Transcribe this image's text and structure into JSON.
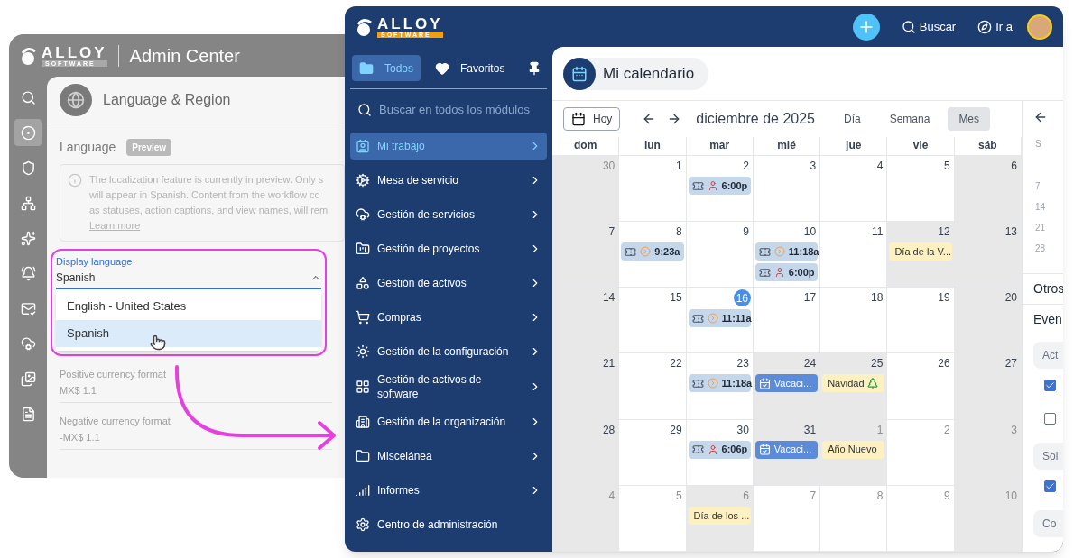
{
  "admin_window": {
    "logo": {
      "name": "ALLOY",
      "sub": "SOFTWARE"
    },
    "title": "Admin Center",
    "rail_items": [
      {
        "selected": false
      },
      {
        "selected": true
      },
      {
        "selected": false
      },
      {
        "selected": false
      },
      {
        "selected": false
      },
      {
        "selected": false
      },
      {
        "selected": false
      },
      {
        "selected": false
      },
      {
        "selected": false
      },
      {
        "selected": false
      }
    ],
    "page_title": "Language & Region",
    "section": "Language",
    "badge": "Preview",
    "info_lines": [
      "The localization feature is currently in preview. Only s",
      "will appear in Spanish. Content from the workflow co",
      "as statuses, action captions, and view names, will rem"
    ],
    "info_link": "Learn more",
    "display_language": {
      "label": "Display language",
      "value": "Spanish",
      "expanded": true,
      "options": [
        {
          "label": "English - United States",
          "selected": false
        },
        {
          "label": "Spanish",
          "selected": true
        }
      ]
    },
    "fields": [
      {
        "label": "Positive currency format",
        "value": "MX$ 1.1"
      },
      {
        "label": "Negative currency format",
        "value": "-MX$ 1.1"
      }
    ]
  },
  "app_window": {
    "logo": {
      "name": "ALLOY",
      "sub": "SOFTWARE"
    },
    "search": "Buscar",
    "goto": "Ir a",
    "tabs": [
      {
        "label": "Todos",
        "selected": true
      },
      {
        "label": "Favoritos",
        "selected": false
      }
    ],
    "search_placeholder": "Buscar en todos los módulos",
    "menu": [
      {
        "label": "Mi trabajo",
        "selected": true
      },
      {
        "label": "Mesa de servicio",
        "selected": false
      },
      {
        "label": "Gestión de servicios",
        "selected": false
      },
      {
        "label": "Gestión de proyectos",
        "selected": false
      },
      {
        "label": "Gestión de activos",
        "selected": false
      },
      {
        "label": "Compras",
        "selected": false
      },
      {
        "label": "Gestión de la configuración",
        "selected": false
      },
      {
        "label": "Gestión de activos de software",
        "selected": false
      },
      {
        "label": "Gestión de la organización",
        "selected": false
      },
      {
        "label": "Miscelánea",
        "selected": false
      },
      {
        "label": "Informes",
        "selected": false
      },
      {
        "label": "Centro de administración",
        "selected": false
      }
    ],
    "page_title": "Mi calendario",
    "calendar": {
      "today_button": "Hoy",
      "month": "diciembre de 2025",
      "views": [
        {
          "label": "Día",
          "selected": false
        },
        {
          "label": "Semana",
          "selected": false
        },
        {
          "label": "Mes",
          "selected": true
        }
      ],
      "weekdays": [
        "dom",
        "lun",
        "mar",
        "mié",
        "jue",
        "vie",
        "sáb"
      ],
      "weeks": [
        [
          {
            "day": "30",
            "muted": true,
            "shaded": true
          },
          {
            "day": "1",
            "muted": false,
            "shaded": false
          },
          {
            "day": "2",
            "muted": false,
            "shaded": false,
            "events": [
              {
                "kind": "ticket",
                "assigned": true,
                "label": "6:00p"
              }
            ]
          },
          {
            "day": "3",
            "muted": false,
            "shaded": false
          },
          {
            "day": "4",
            "muted": false,
            "shaded": false
          },
          {
            "day": "5",
            "muted": false,
            "shaded": false
          },
          {
            "day": "6",
            "muted": false,
            "shaded": true
          }
        ],
        [
          {
            "day": "7",
            "muted": false,
            "shaded": true
          },
          {
            "day": "8",
            "muted": false,
            "shaded": false,
            "events": [
              {
                "kind": "ticket",
                "assigned": false,
                "label": "9:23a"
              }
            ]
          },
          {
            "day": "9",
            "muted": false,
            "shaded": false
          },
          {
            "day": "10",
            "muted": false,
            "shaded": false,
            "events": [
              {
                "kind": "ticket",
                "assigned": false,
                "label": "11:18a"
              },
              {
                "kind": "ticket",
                "assigned": true,
                "label": "6:00p"
              }
            ]
          },
          {
            "day": "11",
            "muted": false,
            "shaded": false
          },
          {
            "day": "12",
            "muted": false,
            "shaded": true,
            "events": [
              {
                "kind": "holiday",
                "label": "Día de la V...",
                "tree": false
              }
            ]
          },
          {
            "day": "13",
            "muted": false,
            "shaded": true
          }
        ],
        [
          {
            "day": "14",
            "muted": false,
            "shaded": true
          },
          {
            "day": "15",
            "muted": false,
            "shaded": false
          },
          {
            "day": "16",
            "muted": false,
            "shaded": false,
            "today": true,
            "events": [
              {
                "kind": "ticket",
                "assigned": false,
                "label": "11:11a"
              }
            ]
          },
          {
            "day": "17",
            "muted": false,
            "shaded": false
          },
          {
            "day": "18",
            "muted": false,
            "shaded": false
          },
          {
            "day": "19",
            "muted": false,
            "shaded": false
          },
          {
            "day": "20",
            "muted": false,
            "shaded": true
          }
        ],
        [
          {
            "day": "21",
            "muted": false,
            "shaded": true
          },
          {
            "day": "22",
            "muted": false,
            "shaded": false
          },
          {
            "day": "23",
            "muted": false,
            "shaded": false,
            "events": [
              {
                "kind": "ticket",
                "assigned": false,
                "label": "11:18a"
              }
            ]
          },
          {
            "day": "24",
            "muted": false,
            "shaded": true,
            "events": [
              {
                "kind": "vacation",
                "label": "Vacaci..."
              }
            ]
          },
          {
            "day": "25",
            "muted": false,
            "shaded": true,
            "events": [
              {
                "kind": "holiday",
                "label": "Navidad",
                "tree": true
              }
            ]
          },
          {
            "day": "26",
            "muted": false,
            "shaded": false
          },
          {
            "day": "27",
            "muted": false,
            "shaded": true
          }
        ],
        [
          {
            "day": "28",
            "muted": false,
            "shaded": true
          },
          {
            "day": "29",
            "muted": false,
            "shaded": false
          },
          {
            "day": "30",
            "muted": false,
            "shaded": false,
            "events": [
              {
                "kind": "ticket",
                "assigned": true,
                "label": "6:06p"
              }
            ]
          },
          {
            "day": "31",
            "muted": false,
            "shaded": true,
            "events": [
              {
                "kind": "vacation",
                "label": "Vacaci..."
              }
            ]
          },
          {
            "day": "1",
            "muted": true,
            "shaded": true,
            "events": [
              {
                "kind": "holiday",
                "label": "Año Nuevo",
                "tree": false
              }
            ]
          },
          {
            "day": "2",
            "muted": true,
            "shaded": false
          },
          {
            "day": "3",
            "muted": true,
            "shaded": true
          }
        ],
        [
          {
            "day": "4",
            "muted": true,
            "shaded": true
          },
          {
            "day": "5",
            "muted": true,
            "shaded": false
          },
          {
            "day": "6",
            "muted": true,
            "shaded": true,
            "events": [
              {
                "kind": "holiday",
                "label": "Día de los ...",
                "tree": false
              }
            ]
          },
          {
            "day": "7",
            "muted": true,
            "shaded": false
          },
          {
            "day": "8",
            "muted": true,
            "shaded": false
          },
          {
            "day": "9",
            "muted": true,
            "shaded": false
          },
          {
            "day": "10",
            "muted": true,
            "shaded": true
          }
        ]
      ]
    },
    "side_panel": {
      "mini_calendar": [
        "S",
        "7",
        "14",
        "21",
        "28"
      ],
      "items": [
        {
          "kind": "heading",
          "label": "Otros"
        },
        {
          "kind": "heading",
          "label": "Even"
        },
        {
          "kind": "pill",
          "label": "Act"
        },
        {
          "kind": "checkbox",
          "checked": true
        },
        {
          "kind": "checkbox",
          "checked": false
        },
        {
          "kind": "pill",
          "label": "Sol"
        },
        {
          "kind": "checkbox",
          "checked": true
        },
        {
          "kind": "pill",
          "label": "Co"
        }
      ]
    }
  }
}
